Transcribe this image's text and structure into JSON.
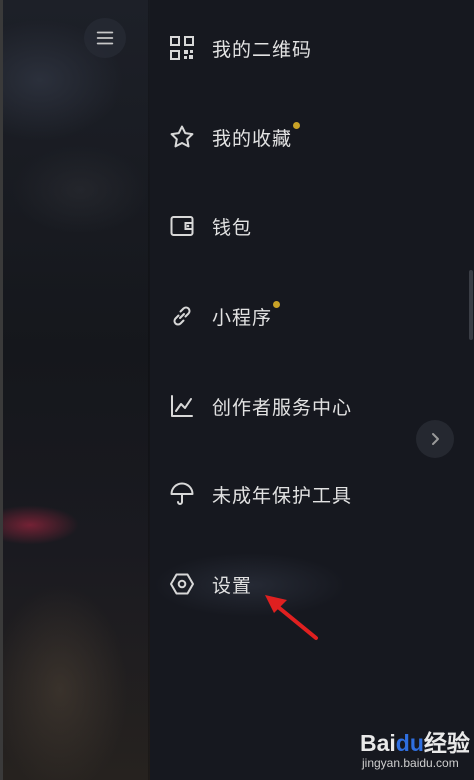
{
  "menu": {
    "items": [
      {
        "label": "我的二维码",
        "icon": "qr-code-icon",
        "dot": false
      },
      {
        "label": "我的收藏",
        "icon": "star-icon",
        "dot": true
      },
      {
        "label": "钱包",
        "icon": "wallet-icon",
        "dot": false
      },
      {
        "label": "小程序",
        "icon": "link-icon",
        "dot": true
      },
      {
        "label": "创作者服务中心",
        "icon": "chart-icon",
        "dot": false
      },
      {
        "label": "未成年保护工具",
        "icon": "umbrella-icon",
        "dot": false
      },
      {
        "label": "设置",
        "icon": "settings-icon",
        "dot": false
      }
    ]
  },
  "colors": {
    "badge_dot": "#c9a227",
    "arrow": "#e02020",
    "background": "#16181f"
  },
  "watermark": {
    "brand_text": "Bai",
    "brand_paw": "du",
    "brand_suffix": "经验",
    "url": "jingyan.baidu.com"
  }
}
